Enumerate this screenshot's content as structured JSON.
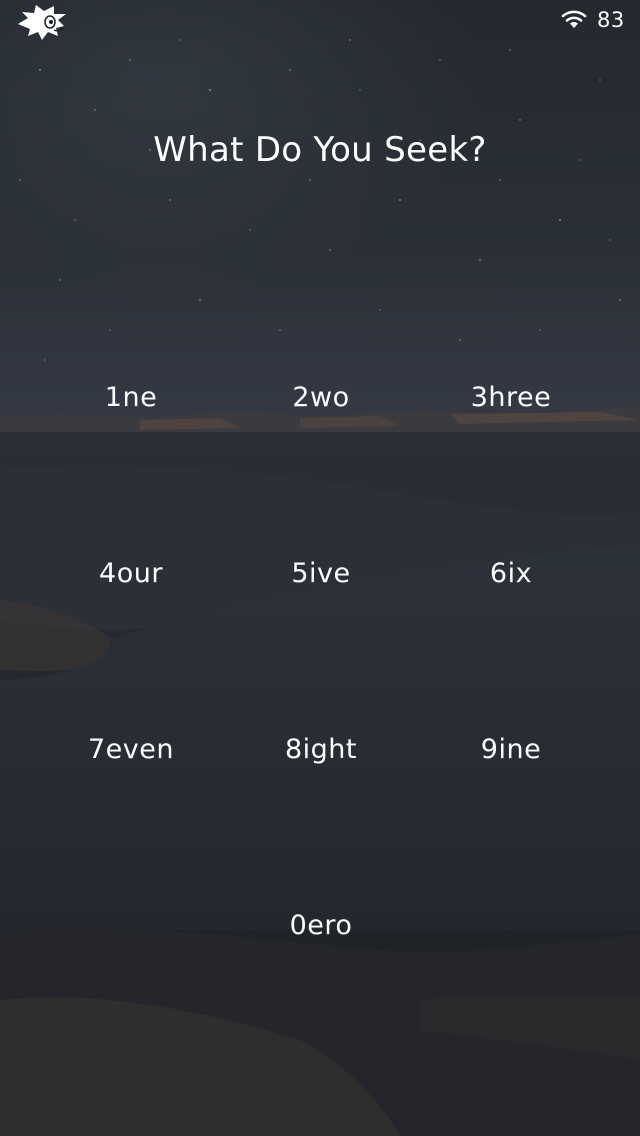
{
  "status_bar": {
    "logo_icon": "hedgehog-logo-icon",
    "wifi_icon": "wifi-icon",
    "battery_level": "83"
  },
  "title": "What Do You Seek?",
  "keypad": {
    "keys": [
      {
        "label": "1ne",
        "digit": "1"
      },
      {
        "label": "2wo",
        "digit": "2"
      },
      {
        "label": "3hree",
        "digit": "3"
      },
      {
        "label": "4our",
        "digit": "4"
      },
      {
        "label": "5ive",
        "digit": "5"
      },
      {
        "label": "6ix",
        "digit": "6"
      },
      {
        "label": "7even",
        "digit": "7"
      },
      {
        "label": "8ight",
        "digit": "8"
      },
      {
        "label": "9ine",
        "digit": "9"
      },
      {
        "label": "0ero",
        "digit": "0"
      }
    ]
  },
  "colors": {
    "text": "#ffffff",
    "sky_top": "#23282f",
    "sky_bottom": "#2c3038",
    "ground": "#262a31"
  }
}
